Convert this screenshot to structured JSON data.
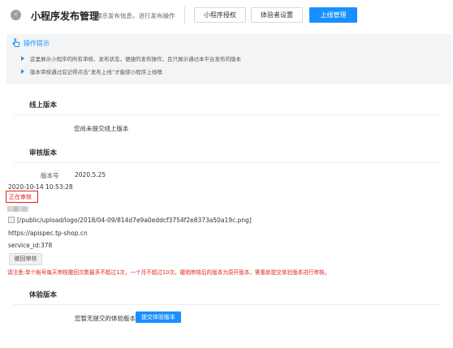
{
  "header": {
    "back_icon": "chevron-left-icon",
    "title": "小程序发布管理",
    "subtitle": "展示发布信息，进行发布操作",
    "tabs": [
      {
        "label": "小程序授权",
        "active": false
      },
      {
        "label": "体验者设置",
        "active": false
      },
      {
        "label": "上线管理",
        "active": true
      }
    ]
  },
  "tips": {
    "icon": "hand-pointer-icon",
    "title": "操作提示",
    "items": [
      "这里展示小程序的所有审核、发布状态，便捷的发布操作，且只展示通过本平台发布的版本",
      "版本审核通过后记得点击“发布上线”才能使小程序上线噢"
    ]
  },
  "online": {
    "title": "线上版本",
    "empty_text": "您尚未提交线上版本"
  },
  "review": {
    "title": "审核版本",
    "version_label": "版本号",
    "version_value": "2020.5.25",
    "datetime": "2020-10-14 10:53:28",
    "status": "正在审核",
    "image_alt": "[/public/upload/logo/2018/04-09/814d7e9a0eddcf3754f2e8373a50a19c.png]",
    "url": "https://apispec.tp-shop.cn",
    "service_id": "service_id:378",
    "withdraw_label": "撤回审核",
    "warning": "请注意:单个帐号每天审核撤回次数最多不超过1次，一个月不超过10次。撤销审核后的版本为原开版本，需重新提交体验版本进行审核。"
  },
  "trial": {
    "title": "体验版本",
    "empty_text": "您暂无提交的体验版本",
    "submit_label": "提交体验版本"
  },
  "colors": {
    "accent": "#1890ff",
    "danger": "#e02424"
  }
}
